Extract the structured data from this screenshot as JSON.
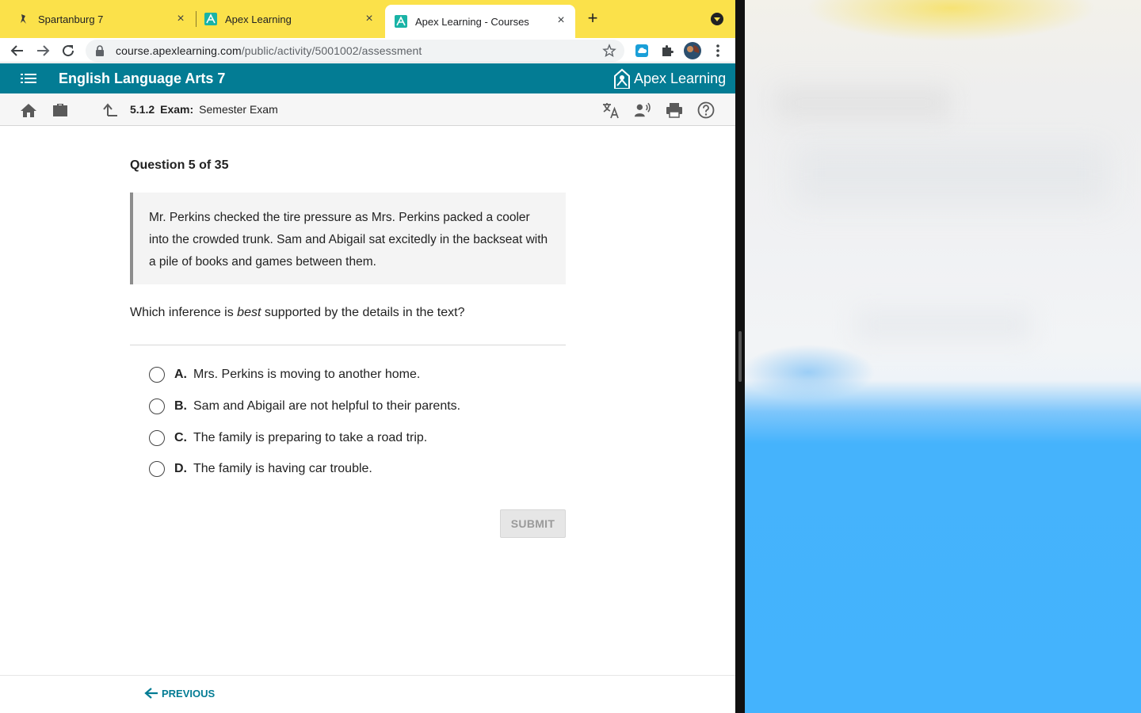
{
  "browser": {
    "tabs": [
      {
        "title": "Spartanburg 7",
        "active": false
      },
      {
        "title": "Apex Learning",
        "active": false
      },
      {
        "title": "Apex Learning - Courses",
        "active": true
      }
    ],
    "url_host": "course.apexlearning.com",
    "url_path": "/public/activity/5001002/assessment"
  },
  "app": {
    "course_title": "English Language Arts 7",
    "logo_text": "Apex Learning",
    "breadcrumb_number": "5.1.2",
    "breadcrumb_type": "Exam:",
    "breadcrumb_title": "Semester Exam"
  },
  "question": {
    "counter": "Question 5 of 35",
    "passage": "Mr. Perkins checked the tire pressure as Mrs. Perkins packed a cooler into the crowded trunk. Sam and Abigail sat excitedly in the backseat with a pile of books and games between them.",
    "prompt_before": "Which inference is ",
    "prompt_emphasis": "best",
    "prompt_after": " supported by the details in the text?",
    "choices": [
      {
        "letter": "A.",
        "text": "Mrs. Perkins is moving to another home."
      },
      {
        "letter": "B.",
        "text": "Sam and Abigail are not helpful to their parents."
      },
      {
        "letter": "C.",
        "text": "The family is preparing to take a road trip."
      },
      {
        "letter": "D.",
        "text": "The family is having car trouble."
      }
    ],
    "submit_label": "SUBMIT"
  },
  "footer": {
    "previous_label": "PREVIOUS"
  },
  "colors": {
    "tabbar": "#fbe14a",
    "apex_teal": "#037c94",
    "wallpaper_blue": "#44b3fd"
  }
}
